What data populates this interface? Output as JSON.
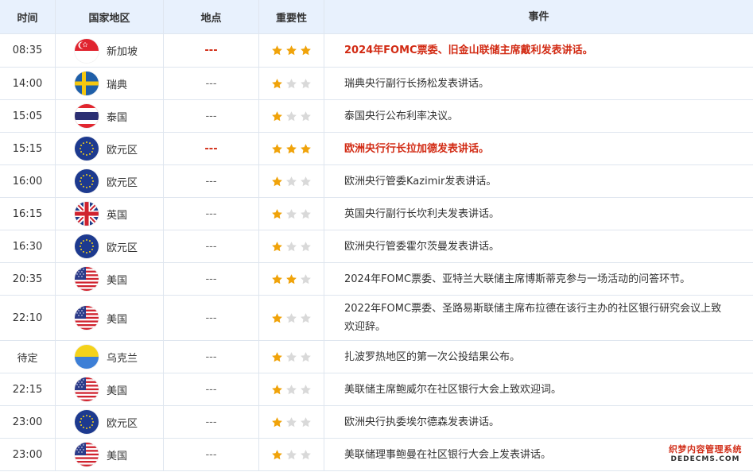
{
  "header": {
    "time": "时间",
    "country": "国家地区",
    "place": "地点",
    "importance": "重要性",
    "event": "事件"
  },
  "colors": {
    "highlight": "#d22b14",
    "header_bg": "#e8f1fd",
    "border": "#dfe6ef",
    "star_on": "#f0a30a",
    "star_off": "#d9d9d9"
  },
  "rows": [
    {
      "time": "08:35",
      "flag": "singapore-flag-icon",
      "country": "新加坡",
      "place": "---",
      "importance": 3,
      "event": "2024年FOMC票委、旧金山联储主席戴利发表讲话。",
      "highlight": true
    },
    {
      "time": "14:00",
      "flag": "sweden-flag-icon",
      "country": "瑞典",
      "place": "---",
      "importance": 1,
      "event": "瑞典央行副行长扬松发表讲话。",
      "highlight": false
    },
    {
      "time": "15:05",
      "flag": "thailand-flag-icon",
      "country": "泰国",
      "place": "---",
      "importance": 1,
      "event": "泰国央行公布利率决议。",
      "highlight": false
    },
    {
      "time": "15:15",
      "flag": "eu-flag-icon",
      "country": "欧元区",
      "place": "---",
      "importance": 3,
      "event": "欧洲央行行长拉加德发表讲话。",
      "highlight": true
    },
    {
      "time": "16:00",
      "flag": "eu-flag-icon",
      "country": "欧元区",
      "place": "---",
      "importance": 1,
      "event": "欧洲央行管委Kazimir发表讲话。",
      "highlight": false
    },
    {
      "time": "16:15",
      "flag": "uk-flag-icon",
      "country": "英国",
      "place": "---",
      "importance": 1,
      "event": "英国央行副行长坎利夫发表讲话。",
      "highlight": false
    },
    {
      "time": "16:30",
      "flag": "eu-flag-icon",
      "country": "欧元区",
      "place": "---",
      "importance": 1,
      "event": "欧洲央行管委霍尔茨曼发表讲话。",
      "highlight": false
    },
    {
      "time": "20:35",
      "flag": "usa-flag-icon",
      "country": "美国",
      "place": "---",
      "importance": 2,
      "event": "2024年FOMC票委、亚特兰大联储主席博斯蒂克参与一场活动的问答环节。",
      "highlight": false
    },
    {
      "time": "22:10",
      "flag": "usa-flag-icon",
      "country": "美国",
      "place": "---",
      "importance": 1,
      "event": "2022年FOMC票委、圣路易斯联储主席布拉德在该行主办的社区银行研究会议上致欢迎辞。",
      "highlight": false
    },
    {
      "time": "待定",
      "flag": "ukraine-flag-icon",
      "country": "乌克兰",
      "place": "---",
      "importance": 1,
      "event": "扎波罗热地区的第一次公投结果公布。",
      "highlight": false
    },
    {
      "time": "22:15",
      "flag": "usa-flag-icon",
      "country": "美国",
      "place": "---",
      "importance": 1,
      "event": "美联储主席鲍威尔在社区银行大会上致欢迎词。",
      "highlight": false
    },
    {
      "time": "23:00",
      "flag": "eu-flag-icon",
      "country": "欧元区",
      "place": "---",
      "importance": 1,
      "event": "欧洲央行执委埃尔德森发表讲话。",
      "highlight": false
    },
    {
      "time": "23:00",
      "flag": "usa-flag-icon",
      "country": "美国",
      "place": "---",
      "importance": 1,
      "event": "美联储理事鲍曼在社区银行大会上发表讲话。",
      "highlight": false
    }
  ],
  "watermark": {
    "line1": "织梦内容管理系统",
    "line2": "DEDECMS.COM"
  }
}
